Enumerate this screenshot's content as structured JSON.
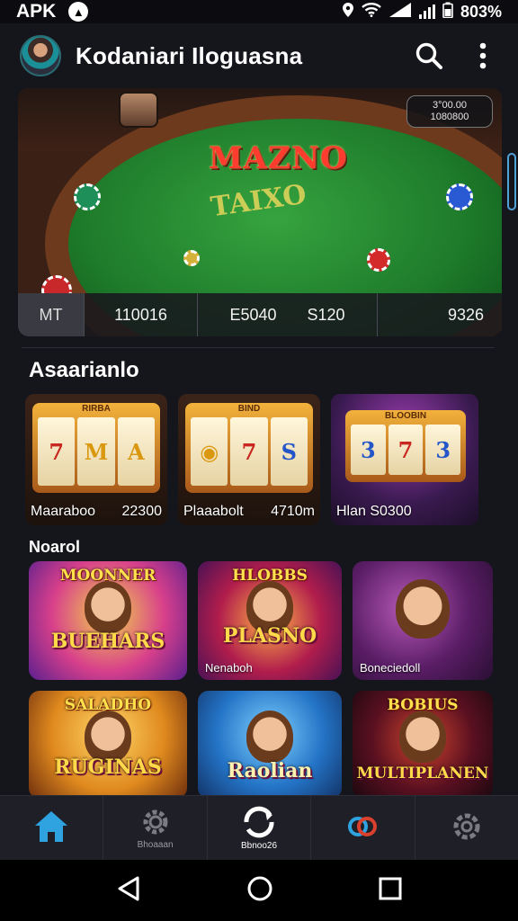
{
  "status_bar": {
    "carrier": "APK",
    "badge": "▲",
    "battery": "803%"
  },
  "header": {
    "title": "Kodaniari Iloguasna"
  },
  "hero": {
    "title": "MAZNO",
    "felt_text": "TAIXO",
    "badge_line1": "3°00.00",
    "badge_line2": "1080800",
    "stats": {
      "tab": "MT",
      "s2": "110016",
      "s3a": "E5040",
      "s3b": "S120",
      "s4": "9326"
    }
  },
  "section1": {
    "title": "Asaarianlo"
  },
  "slots": [
    {
      "frame_label": "RIRBA",
      "reels": [
        "7",
        "M",
        "A"
      ],
      "name": "Maaraboo",
      "value": "22300"
    },
    {
      "frame_label": "BIND",
      "reels": [
        "◉",
        "7",
        "S"
      ],
      "name": "Plaaabolt",
      "value": "4710m"
    },
    {
      "frame_label": "BLOOBIN",
      "reels": [
        "3",
        "7",
        "3"
      ],
      "name": "Hlan S0300",
      "value": ""
    }
  ],
  "section2": {
    "title": "Noarol"
  },
  "tiles": [
    {
      "top": "MOONNER",
      "banner": "BUEHARS",
      "caption": ""
    },
    {
      "top": "HLOBBS",
      "banner": "PLASNO",
      "caption": "Nenaboh"
    },
    {
      "top": "",
      "banner": "",
      "caption": "Boneciedoll"
    },
    {
      "top": "SALADHO",
      "banner": "RUGINAS",
      "caption": ""
    },
    {
      "top": "",
      "banner": "Raolian",
      "caption": ""
    },
    {
      "top": "BOBIUS",
      "banner": "MULTIPLANEN",
      "caption": ""
    }
  ],
  "bottom_nav": {
    "items": [
      {
        "label": ""
      },
      {
        "label": "Bhoaaan"
      },
      {
        "label": "Bbnoo26"
      },
      {
        "label": ""
      },
      {
        "label": ""
      }
    ]
  },
  "colors": {
    "accent": "#2fa3e0",
    "background": "#15151c",
    "felt": "#1d7a2a"
  }
}
